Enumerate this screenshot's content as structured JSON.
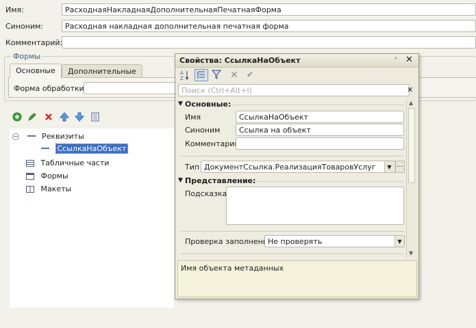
{
  "main": {
    "name_label": "Имя:",
    "name_value": "РасходнаяНакладнаяДополнительнаяПечатнаяФорма",
    "synonym_label": "Синоним:",
    "synonym_value": "Расходная накладная дополнительная печатная форма",
    "comment_label": "Комментарий:",
    "comment_value": "",
    "forms_group_title": "Формы",
    "tabs": [
      {
        "label": "Основные"
      },
      {
        "label": "Дополнительные"
      }
    ],
    "form_processing_label": "Форма обработки:",
    "form_processing_value": ""
  },
  "toolbar": {
    "icons": [
      "add-icon",
      "edit-icon",
      "delete-icon",
      "move-up-icon",
      "move-down-icon",
      "list-icon"
    ]
  },
  "tree": {
    "items": [
      {
        "label": "Реквизиты"
      },
      {
        "label": "СсылкаНаОбъект"
      },
      {
        "label": "Табличные части"
      },
      {
        "label": "Формы"
      },
      {
        "label": "Макеты"
      }
    ]
  },
  "properties_window": {
    "title": "Свойства: СсылкаНаОбъект",
    "pin_glyph": "ᵠ",
    "close_glyph": "✕",
    "search_placeholder": "Поиск (Ctrl+Alt+I)",
    "section_main": "Основные:",
    "name_label": "Имя",
    "name_value": "СсылкаНаОбъект",
    "synonym_label": "Синоним",
    "synonym_value": "Ссылка на объект",
    "comment_label": "Комментарий",
    "comment_value": "",
    "type_label": "Тип",
    "type_value": "ДокументСсылка.РеализацияТоваровУслуг",
    "section_view": "Представление:",
    "hint_label": "Подсказка",
    "hint_value": "",
    "fill_check_label": "Проверка заполнения",
    "fill_check_value": "Не проверять",
    "description": "Имя объекта метаданных"
  }
}
